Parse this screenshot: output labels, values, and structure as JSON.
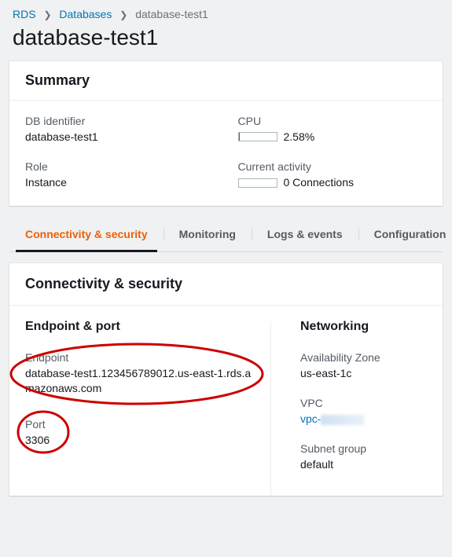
{
  "breadcrumb": {
    "root": "RDS",
    "level1": "Databases",
    "current": "database-test1"
  },
  "page_title": "database-test1",
  "summary": {
    "heading": "Summary",
    "db_identifier_label": "DB identifier",
    "db_identifier_value": "database-test1",
    "role_label": "Role",
    "role_value": "Instance",
    "cpu_label": "CPU",
    "cpu_value": "2.58%",
    "activity_label": "Current activity",
    "activity_value": "0 Connections"
  },
  "tabs": {
    "t0": "Connectivity & security",
    "t1": "Monitoring",
    "t2": "Logs & events",
    "t3": "Configuration"
  },
  "conn": {
    "heading": "Connectivity & security",
    "endpoint_port_heading": "Endpoint & port",
    "endpoint_label": "Endpoint",
    "endpoint_value": "database-test1.123456789012.us-east-1.rds.amazonaws.com",
    "port_label": "Port",
    "port_value": "3306",
    "networking_heading": "Networking",
    "az_label": "Availability Zone",
    "az_value": "us-east-1c",
    "vpc_label": "VPC",
    "vpc_link_text": "vpc-",
    "subnet_label": "Subnet group",
    "subnet_value": "default"
  },
  "annotation_color": "#cc0000"
}
